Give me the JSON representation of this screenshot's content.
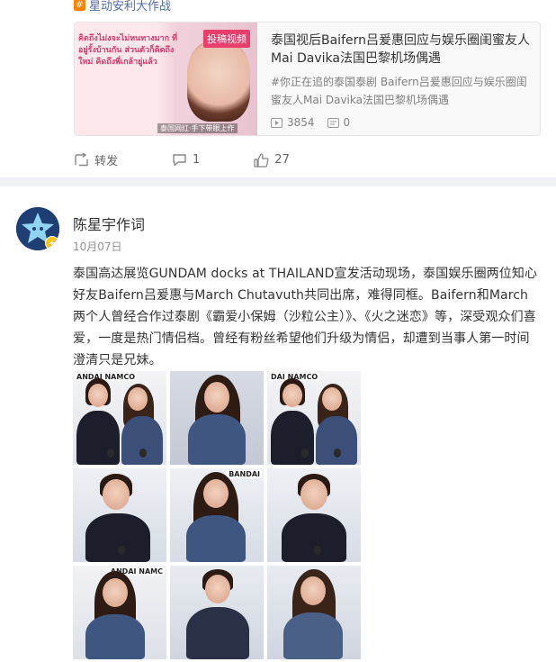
{
  "post1": {
    "topic": "星动安利大作战",
    "link_card": {
      "thumb_badge": "投稿视频",
      "thumb_caption": "泰国网红·手下带眼上作",
      "thumb_text": "คิดถึงไม่งจะไม่หนทางมาก ที่อยู่รั้งบ้านกัน ส่วนตัวก็คิดถึงใหม่ คิดถึงพี่เกล้ายู่แล้ว",
      "title": "泰国视后Baifern吕爰惠回应与娱乐圈闺蜜友人Mai Davika法国巴黎机场偶遇",
      "desc": "#你正在追的泰国泰剧 Baifern吕爰惠回应与娱乐圈闺蜜友人Mai Davika法国巴黎机场偶遇",
      "plays": "3854",
      "comments": "0"
    },
    "actions": {
      "repost": "转发",
      "comment_count": "1",
      "like_count": "27"
    }
  },
  "post2": {
    "author": "陈星宇作词",
    "date": "10月07日",
    "text": "泰国高达展览GUNDAM docks at THAILAND宣发活动现场，泰国娱乐圈两位知心好友Baifern吕爰惠与March Chutavuth共同出席，难得同框。Baifern和March两个人曾经合作过泰剧《霸爱小保姆（沙粒公主）》、《火之迷恋》等，深受观众们喜爱，一度是热门情侣档。曾经有粉丝希望他们升级为情侣，却遭到当事人第一时间澄清只是兄妹。",
    "photos": [
      {
        "label": "ANDAI NAMCO",
        "kind": "couple"
      },
      {
        "label": "",
        "kind": "woman"
      },
      {
        "label": "DAI NAMCO",
        "kind": "couple"
      },
      {
        "label": "",
        "kind": "man"
      },
      {
        "label": "BANDAI",
        "kind": "woman"
      },
      {
        "label": "",
        "kind": "man"
      },
      {
        "label": "ANDAI NAMC",
        "kind": "woman"
      },
      {
        "label": "",
        "kind": "man"
      },
      {
        "label": "",
        "kind": "woman"
      }
    ]
  },
  "colors": {
    "link": "#4f6ea5",
    "accent": "#ff8200",
    "muted": "#808080",
    "background": "#f1f2f5"
  }
}
